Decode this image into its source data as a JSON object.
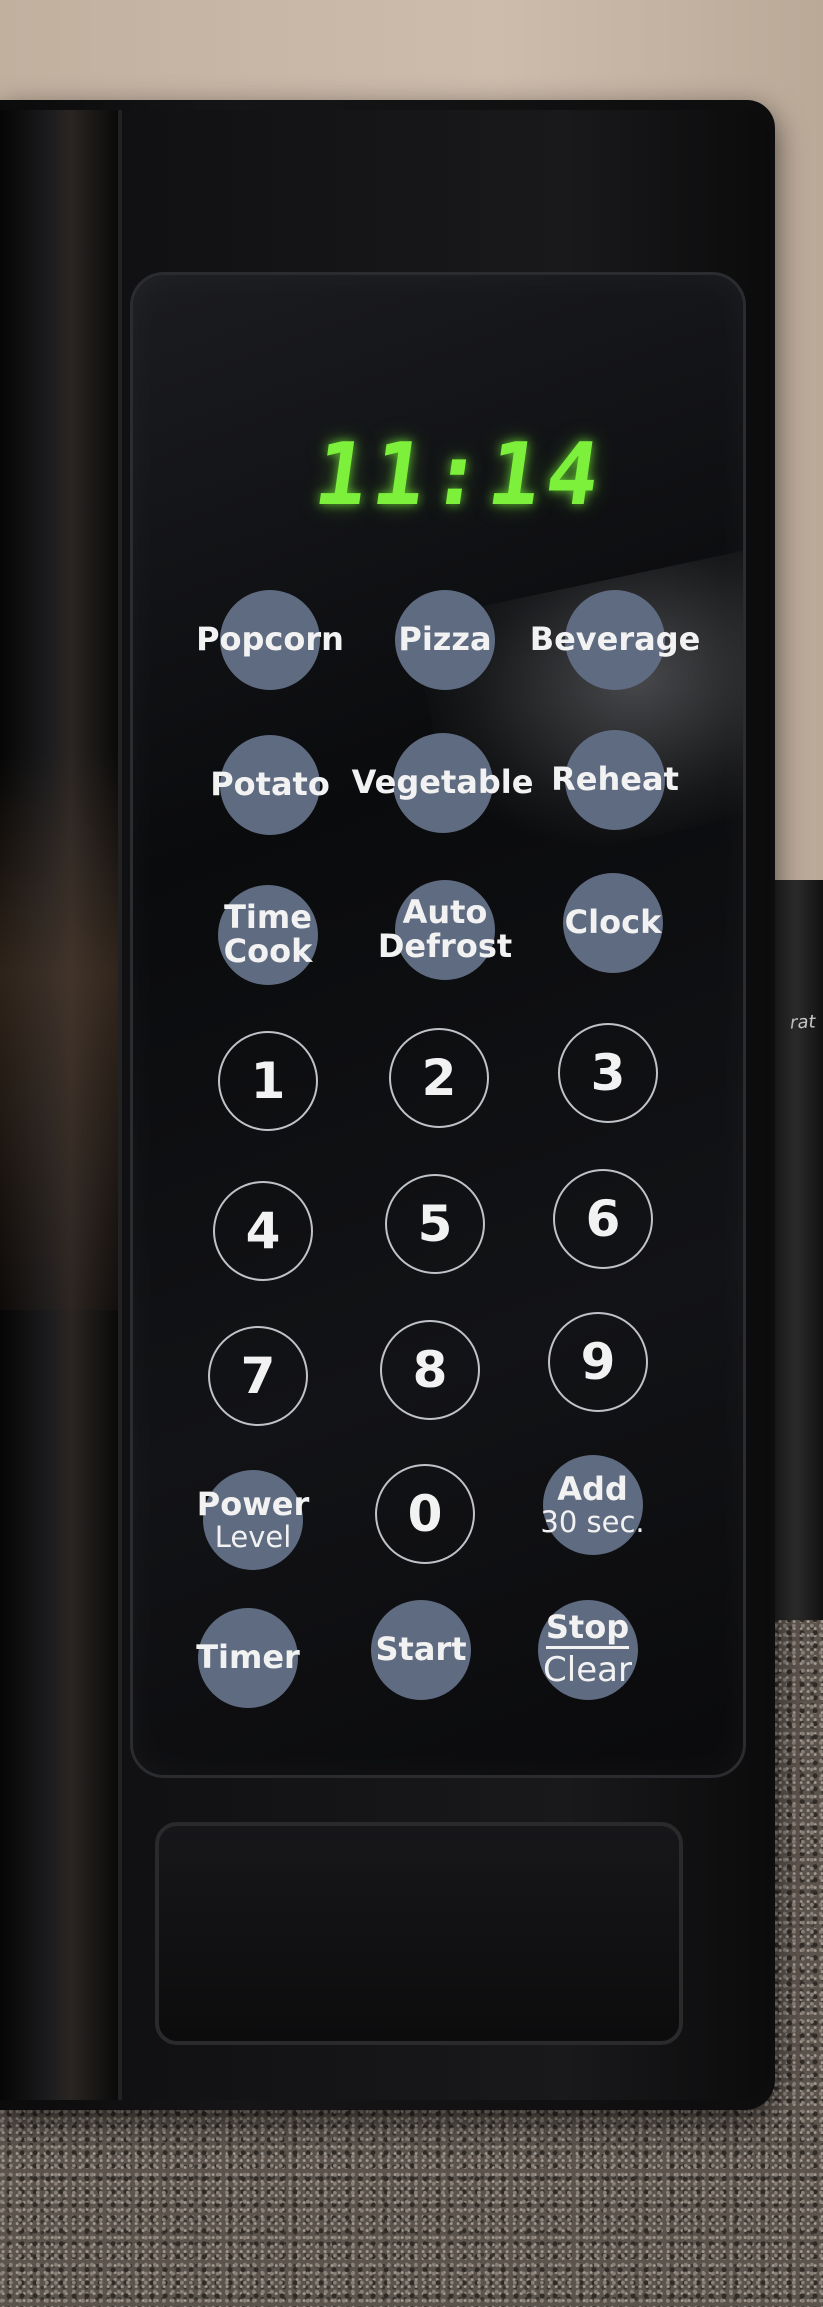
{
  "display": {
    "time": "11:14",
    "color": "#7cf03a"
  },
  "buttons": {
    "popcorn": {
      "label": "Popcorn"
    },
    "pizza": {
      "label": "Pizza"
    },
    "beverage": {
      "label": "Beverage"
    },
    "potato": {
      "label": "Potato"
    },
    "vegetable": {
      "label": "Vegetable"
    },
    "reheat": {
      "label": "Reheat"
    },
    "time_cook": {
      "line1": "Time",
      "line2": "Cook"
    },
    "auto_defrost": {
      "line1": "Auto",
      "line2": "Defrost"
    },
    "clock": {
      "label": "Clock"
    },
    "digits": [
      "1",
      "2",
      "3",
      "4",
      "5",
      "6",
      "7",
      "8",
      "9",
      "0"
    ],
    "power_level": {
      "line1": "Power",
      "line2": "Level"
    },
    "add_30": {
      "line1": "Add",
      "line2": "30 sec."
    },
    "timer": {
      "label": "Timer"
    },
    "start": {
      "label": "Start"
    },
    "stop_clear": {
      "line1": "Stop",
      "line2": "Clear"
    }
  },
  "background_appliance": {
    "label": "rat"
  },
  "colors": {
    "button_fill": "#5f6b80",
    "panel": "#0a0b0d",
    "body": "#111113"
  }
}
